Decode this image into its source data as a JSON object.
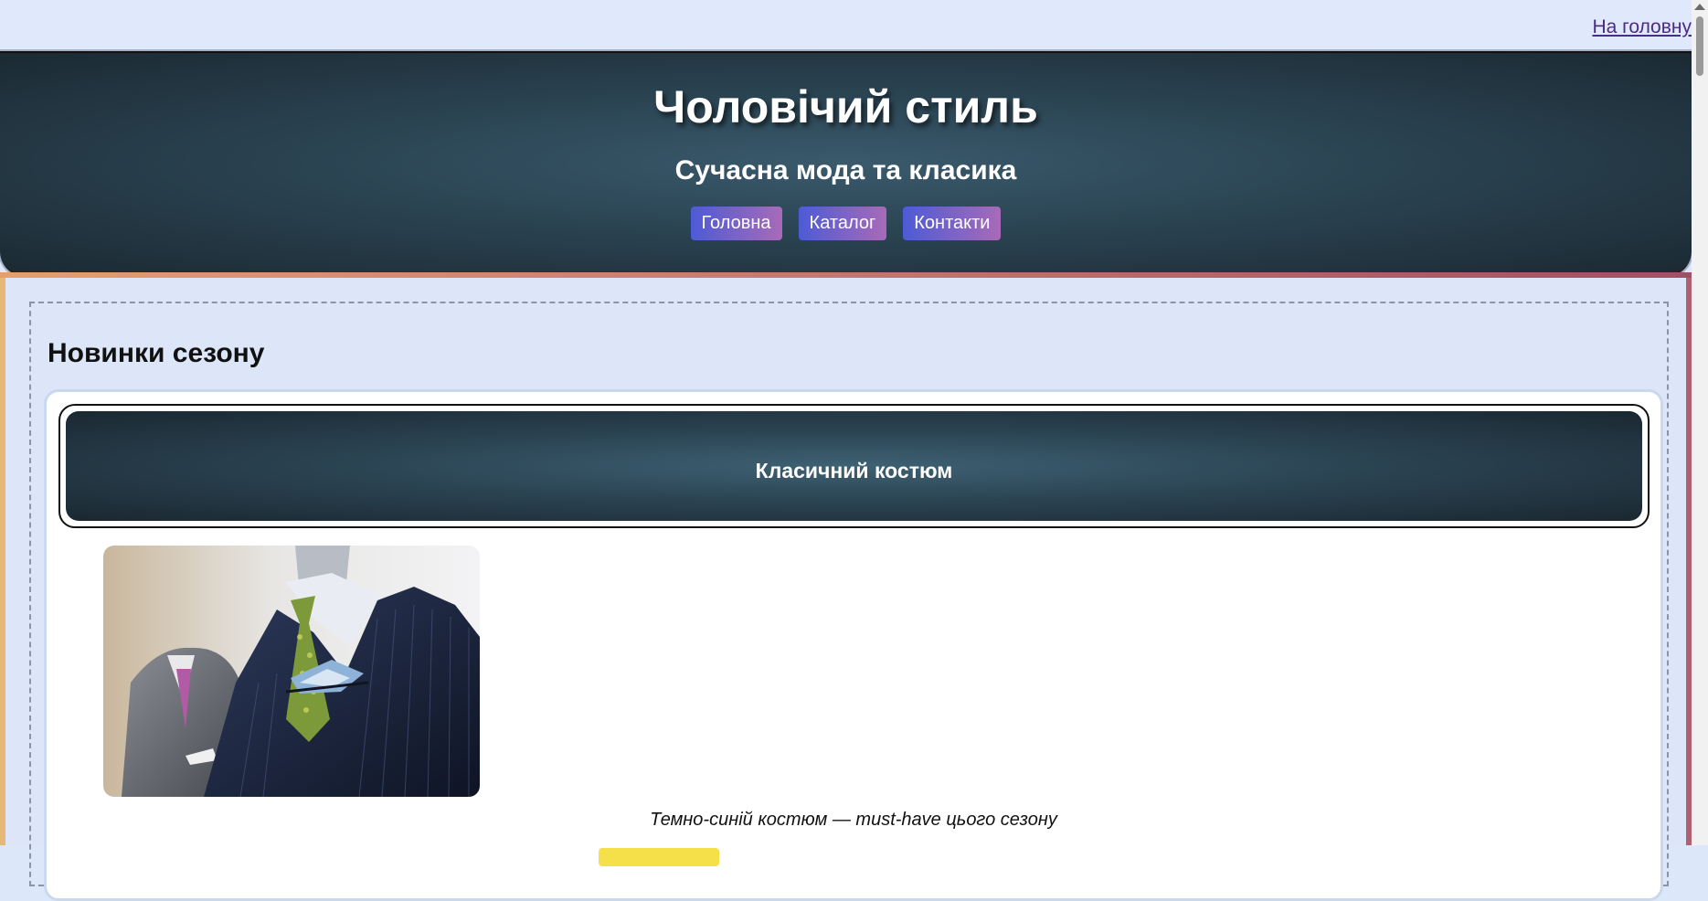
{
  "topbar": {
    "home_link": "На головну"
  },
  "header": {
    "title": "Чоловічий стиль",
    "subtitle": "Сучасна мода та класика",
    "nav": [
      "Головна",
      "Каталог",
      "Контакти"
    ]
  },
  "main": {
    "section_title": "Новинки сезону",
    "product": {
      "title": "Класичний костюм",
      "image_alt": "suit-photo",
      "caption": "Темно-синій костюм — must-have цього сезону"
    }
  },
  "colors": {
    "page_bg": "#dde7fa",
    "header_dark": "#1b2932",
    "header_mid": "#3a5a6c",
    "nav_gradient_start": "#4d5bd6",
    "nav_gradient_end": "#a86ab8",
    "accent_left": "#e2a070",
    "accent_right": "#a05064",
    "price_highlight": "#f5e04a"
  }
}
